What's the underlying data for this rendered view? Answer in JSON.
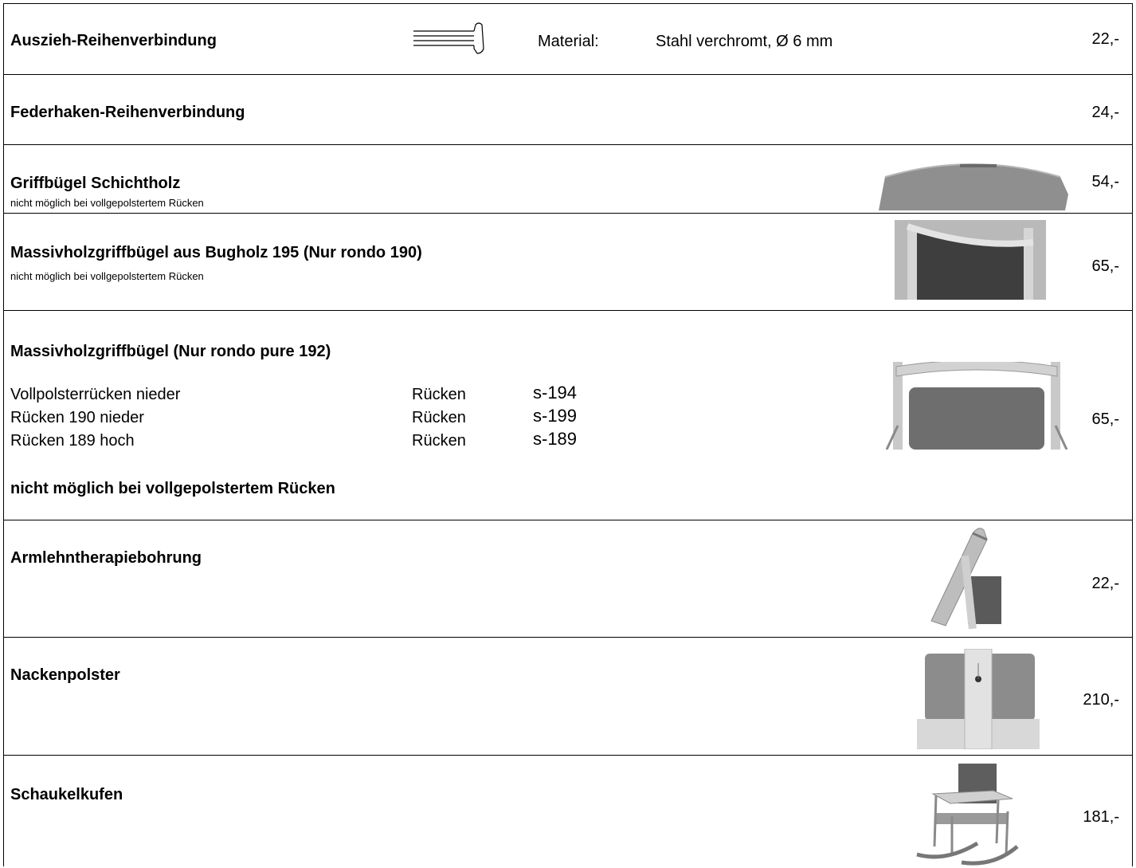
{
  "rows": [
    {
      "title": "Auszieh-Reihenverbindung",
      "material_label": "Material:",
      "material_value": "Stahl verchromt, Ø 6 mm",
      "price": "22,-"
    },
    {
      "title": "Federhaken-Reihenverbindung",
      "price": "24,-"
    },
    {
      "title": "Griffbügel Schichtholz",
      "note": "nicht möglich bei vollgepolstertem Rücken",
      "price": "54,-"
    },
    {
      "title": "Massivholzgriffbügel aus Bugholz 195 (Nur rondo 190)",
      "note": "nicht möglich bei vollgepolstertem Rücken",
      "price": "65,-"
    },
    {
      "title": "Massivholzgriffbügel  (Nur rondo pure 192)",
      "items": [
        {
          "name": "Vollpolsterrücken nieder",
          "type": "Rücken",
          "code": "s-194"
        },
        {
          "name": "Rücken 190 nieder",
          "type": "Rücken",
          "code": "s-199"
        },
        {
          "name": "Rücken 189 hoch",
          "type": "Rücken",
          "code": "s-189"
        }
      ],
      "note": "nicht möglich bei vollgepolstertem Rücken",
      "price": "65,-"
    },
    {
      "title": "Armlehntherapiebohrung",
      "price": "22,-"
    },
    {
      "title": "Nackenpolster",
      "price": "210,-"
    },
    {
      "title": "Schaukelkufen",
      "price": "181,-"
    }
  ],
  "images": {
    "pin": "steel-pin-icon",
    "bow_laminated": "laminated-handle-bow-image",
    "bow_bentwood": "bentwood-handle-bow-image",
    "bow_pure": "chair-back-handle-image",
    "armrest": "armrest-drilling-image",
    "neck": "neck-cushion-image",
    "rocker": "rocking-chair-image"
  }
}
